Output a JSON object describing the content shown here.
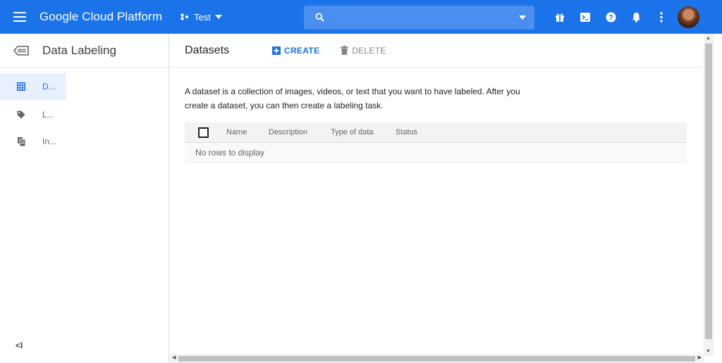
{
  "colors": {
    "accent": "#1a73e8",
    "appbar": "#1a73e8",
    "nav_active_bg": "#e8f0fe"
  },
  "appbar": {
    "brand": "Google Cloud Platform",
    "project": "Test",
    "search_placeholder": "",
    "icons": [
      "menu-icon",
      "project-dots-icon",
      "search-icon",
      "gift-icon",
      "cloud-shell-icon",
      "help-icon",
      "notifications-icon",
      "more-vert-icon",
      "account-avatar"
    ]
  },
  "sidebar": {
    "title": "Data Labeling",
    "items": [
      {
        "label": "D...",
        "icon": "dataset-grid-icon",
        "active": true
      },
      {
        "label": "L...",
        "icon": "label-tag-icon",
        "active": false
      },
      {
        "label": "In...",
        "icon": "instructions-doc-icon",
        "active": false
      }
    ],
    "collapse_label": "<I"
  },
  "main": {
    "title": "Datasets",
    "actions": {
      "create": "CREATE",
      "delete": "DELETE"
    },
    "description": "A dataset is a collection of images, videos, or text that you want to have labeled. After you create a dataset, you can then create a labeling task.",
    "table": {
      "columns": [
        "Name",
        "Description",
        "Type of data",
        "Status"
      ],
      "empty_text": "No rows to display"
    }
  }
}
